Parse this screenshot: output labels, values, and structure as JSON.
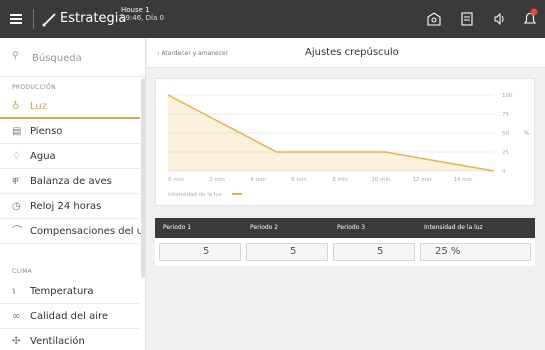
{
  "header": {
    "title": "Estrategia",
    "house": "House 1",
    "time": "09:46, Día 0"
  },
  "sidebar": {
    "search_placeholder": "Búsqueda",
    "section_production": "PRODUCCIÓN",
    "section_climate": "CLIMA",
    "items": [
      {
        "label": "Luz",
        "icon": "bulb-icon",
        "active": true
      },
      {
        "label": "Pienso",
        "icon": "feed-icon"
      },
      {
        "label": "Agua",
        "icon": "water-drop-icon"
      },
      {
        "label": "Balanza de aves",
        "icon": "bird-scale-icon"
      },
      {
        "label": "Reloj 24 horas",
        "icon": "clock-icon"
      },
      {
        "label": "Compensaciones del u...",
        "icon": "compensation-icon"
      },
      {
        "label": "Temperatura",
        "icon": "thermometer-icon"
      },
      {
        "label": "Calidad del aire",
        "icon": "air-quality-icon"
      },
      {
        "label": "Ventilación",
        "icon": "ventilation-icon"
      }
    ]
  },
  "breadcrumb": {
    "back_label": "Atardecer y amanecer"
  },
  "page_title": "Ajustes crepúsculo",
  "chart_data": {
    "type": "area",
    "x": [
      0,
      5,
      10,
      15
    ],
    "x_ticks": [
      "0 min",
      "2 min",
      "4 min",
      "6 min",
      "8 min",
      "10 min",
      "12 min",
      "14 min"
    ],
    "y_ticks": [
      "100",
      "75",
      "50",
      "25",
      "0"
    ],
    "ylabel": "%",
    "ylim": [
      0,
      100
    ],
    "series": [
      {
        "name": "Intensidad de la luz",
        "x": [
          0,
          5,
          10,
          15
        ],
        "values": [
          100,
          25,
          25,
          0
        ]
      }
    ],
    "grid": true,
    "legend_placement": "bottom-left",
    "color": "#e8b34a"
  },
  "table": {
    "headers": [
      "Periodo 1",
      "Periodo 2",
      "Periodo 3",
      "Intensidad de la luz"
    ],
    "values": [
      "5",
      "5",
      "5",
      "25 %"
    ]
  }
}
